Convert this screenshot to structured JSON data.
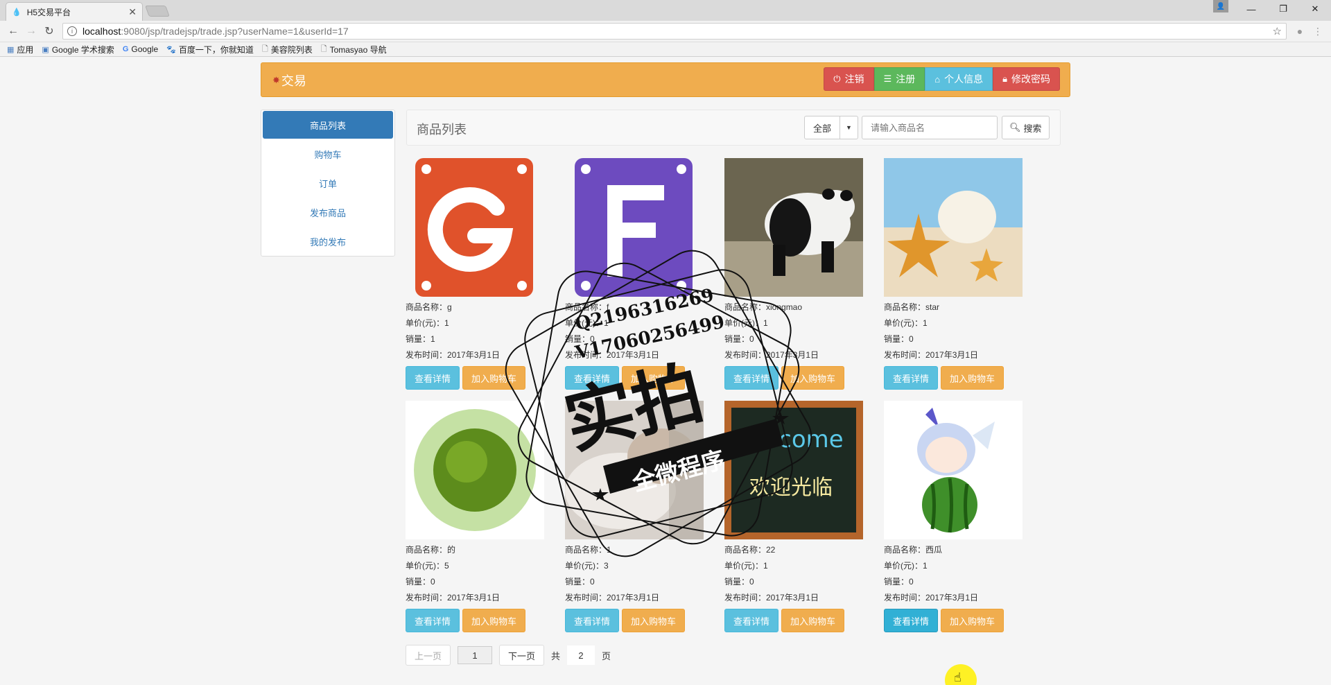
{
  "browser": {
    "tab_title": "H5交易平台",
    "tab_close": "✕",
    "url_host": "localhost",
    "url_path": ":9080/jsp/tradejsp/trade.jsp?userName=1&userId=17",
    "bookmarks": [
      "应用",
      "Google 学术搜索",
      "Google",
      "百度一下，你就知道",
      "美容院列表",
      "Tomasyao 导航"
    ]
  },
  "header": {
    "brand": "交易",
    "buttons": [
      "注销",
      "注册",
      "个人信息",
      "修改密码"
    ]
  },
  "sidebar": {
    "items": [
      "商品列表",
      "购物车",
      "订单",
      "发布商品",
      "我的发布"
    ]
  },
  "main": {
    "title": "商品列表",
    "filter_selected": "全部",
    "search_placeholder": "请输入商品名",
    "search_label": "搜索"
  },
  "products": [
    {
      "name": "商品名称：g",
      "price": "单价(元)：1",
      "sales": "销量：1",
      "date": "发布时间：2017年3月1日",
      "image": "orange-g-icon"
    },
    {
      "name": "商品名称：f",
      "price": "单价(元)：1",
      "sales": "销量：0",
      "date": "发布时间：2017年3月1日",
      "image": "purple-f-icon"
    },
    {
      "name": "商品名称：xiongmao",
      "price": "单价(元)：1",
      "sales": "销量：0",
      "date": "发布时间：2017年3月1日",
      "image": "panda-photo"
    },
    {
      "name": "商品名称：star",
      "price": "单价(元)：1",
      "sales": "销量：0",
      "date": "发布时间：2017年3月1日",
      "image": "starfish-beach-photo"
    },
    {
      "name": "商品名称：的",
      "price": "单价(元)：5",
      "sales": "销量：0",
      "date": "发布时间：2017年3月1日",
      "image": "green-tree-ball-photo"
    },
    {
      "name": "商品名称：1",
      "price": "单价(元)：3",
      "sales": "销量：0",
      "date": "发布时间：2017年3月1日",
      "image": "sleeping-photo"
    },
    {
      "name": "商品名称：22",
      "price": "单价(元)：1",
      "sales": "销量：0",
      "date": "发布时间：2017年3月1日",
      "image": "welcome-chalkboard"
    },
    {
      "name": "商品名称：西瓜",
      "price": "单价(元)：1",
      "sales": "销量：0",
      "date": "发布时间：2017年3月1日",
      "image": "anime-watermelon"
    }
  ],
  "product_buttons": {
    "detail": "查看详情",
    "cart": "加入购物车"
  },
  "pager": {
    "prev": "上一页",
    "current": "1",
    "next": "下一页",
    "total_prefix": "共",
    "total": "2",
    "total_suffix": "页"
  },
  "watermark": {
    "line1": "Q2196316269",
    "line2": "V17060256499",
    "big": "实拍",
    "ribbon": "全微程序"
  },
  "chalkboard": {
    "line1": "welcome",
    "line2": "欢迎光临"
  },
  "colors": {
    "header": "#f0ad4e",
    "primary": "#337ab7",
    "info": "#5bc0de",
    "warning": "#f0ad4e",
    "danger": "#d9534f",
    "success": "#5cb85c"
  }
}
